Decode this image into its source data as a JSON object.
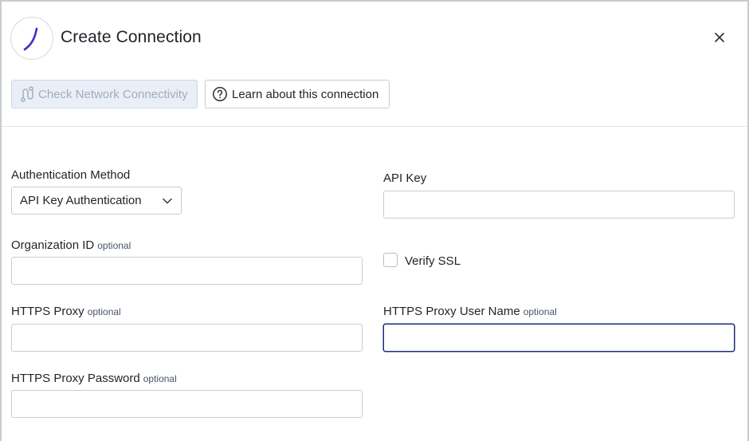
{
  "dialog": {
    "title": "Create Connection",
    "close_icon": "close-icon",
    "logo_icon": "brand-logo-icon"
  },
  "toolbar": {
    "check_network_label": "Check Network Connectivity",
    "check_network_icon": "route-icon",
    "check_network_disabled": true,
    "learn_label": "Learn about this connection",
    "learn_icon": "help-circle-icon"
  },
  "form": {
    "auth_method": {
      "label": "Authentication Method",
      "selected": "API Key Authentication"
    },
    "api_key": {
      "label": "API Key",
      "value": ""
    },
    "organization_id": {
      "label": "Organization ID",
      "optional": "optional",
      "value": ""
    },
    "verify_ssl": {
      "label": "Verify SSL",
      "checked": false
    },
    "https_proxy": {
      "label": "HTTPS Proxy",
      "optional": "optional",
      "value": ""
    },
    "https_proxy_user": {
      "label": "HTTPS Proxy User Name",
      "optional": "optional",
      "value": ""
    },
    "https_proxy_password": {
      "label": "HTTPS Proxy Password",
      "optional": "optional",
      "value": ""
    }
  },
  "colors": {
    "accent": "#3b2fd1",
    "focus_border": "#1f2a7a",
    "disabled_button_bg": "#e9eef7",
    "disabled_button_text": "#a4adbb"
  }
}
